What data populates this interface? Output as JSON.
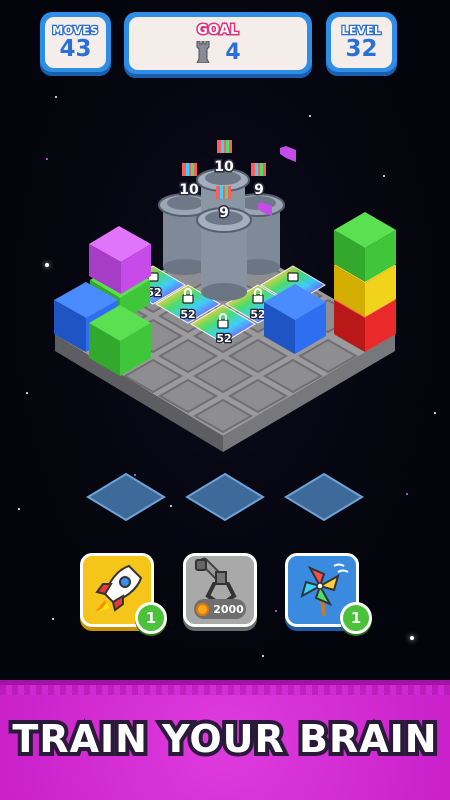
{
  "hud": {
    "moves_label": "MOVES",
    "moves_value": "43",
    "goal_label": "GOAL",
    "goal_icon": "tower-icon",
    "goal_value": "4",
    "level_label": "LEVEL",
    "level_value": "32"
  },
  "board": {
    "tower_levels": [
      "10",
      "10",
      "9",
      "9"
    ],
    "lock_values": [
      "52",
      "52",
      "52",
      "52",
      "52"
    ],
    "colors": {
      "blue": "#2d6ff0",
      "green": "#3fc63a",
      "magenta": "#c64be8",
      "yellow": "#f2d31c",
      "red": "#ea2a2a",
      "tile": "#8d8d90"
    }
  },
  "boosters": [
    {
      "name": "rocket",
      "icon": "rocket-icon",
      "count": "1"
    },
    {
      "name": "grabber",
      "icon": "claw-icon",
      "cost": "2000"
    },
    {
      "name": "pinwheel",
      "icon": "pinwheel-icon",
      "count": "1"
    }
  ],
  "banner": {
    "text": "TRAIN YOUR BRAIN"
  }
}
